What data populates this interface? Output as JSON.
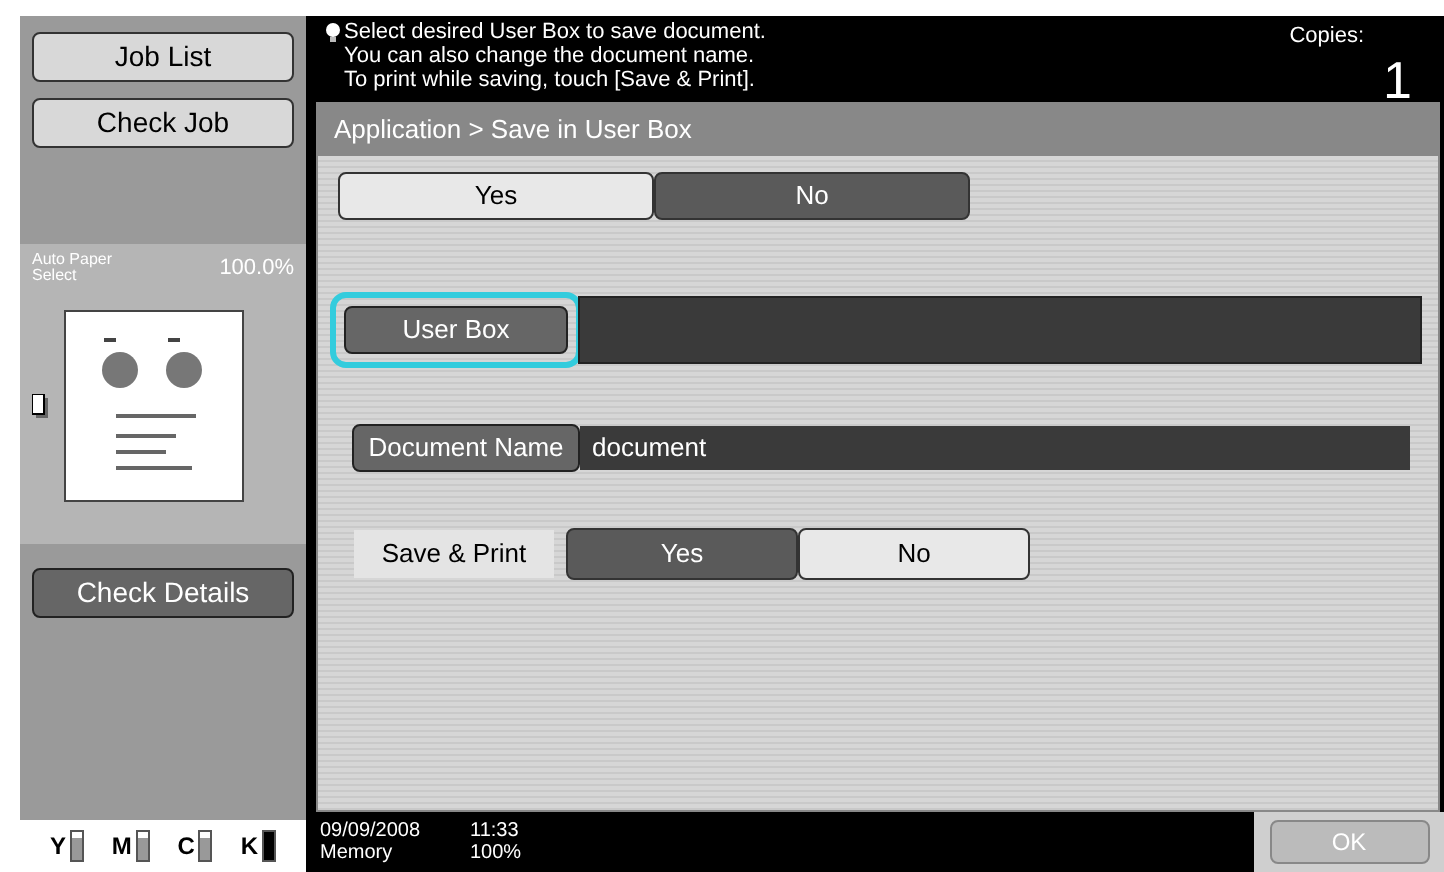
{
  "sidebar": {
    "buttons": [
      {
        "label": "Job List"
      },
      {
        "label": "Check Job"
      }
    ],
    "paper": {
      "label": "Auto Paper Select",
      "zoom": "100.0%"
    },
    "details_button": "Check Details",
    "toner": [
      {
        "label": "Y",
        "level": 0.8
      },
      {
        "label": "M",
        "level": 0.8
      },
      {
        "label": "C",
        "level": 0.8
      },
      {
        "label": "K",
        "level": 1
      }
    ]
  },
  "message": {
    "lines": [
      "Select desired User Box to save document.",
      "You can also change the document name.",
      "To print while saving, touch [Save & Print]."
    ],
    "copies_label": "Copies:",
    "copies": "1"
  },
  "breadcrumb": "Application > Save in User Box",
  "apply_options": [
    {
      "label": "Yes",
      "selected": false
    },
    {
      "label": "No",
      "selected": true
    }
  ],
  "user_box": {
    "label": "User Box",
    "focused": true
  },
  "document_name": {
    "label": "Document Name",
    "value": "document"
  },
  "save_print": {
    "label": "Save & Print",
    "options": [
      {
        "label": "Yes",
        "selected": true
      },
      {
        "label": "No",
        "selected": false
      }
    ]
  },
  "status": {
    "date": "09/09/2008",
    "time": "11:33",
    "memory_label": "Memory",
    "memory": "100%"
  },
  "ok_button": "OK"
}
